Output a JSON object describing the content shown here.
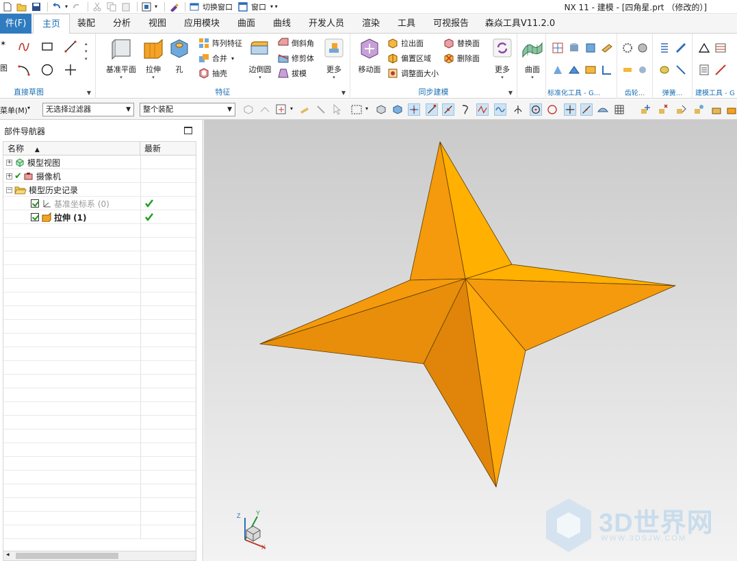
{
  "window": {
    "title": "NX 11 - 建模 - [四角星.prt （修改的）]",
    "quick_access": {
      "switch_window": "切换窗口",
      "window": "窗口"
    }
  },
  "ribbon": {
    "file_tab": "件(F)",
    "tabs": [
      "主页",
      "装配",
      "分析",
      "视图",
      "应用模块",
      "曲面",
      "曲线",
      "开发人员",
      "渲染",
      "工具",
      "可视报告",
      "森焱工具V11.2.0"
    ],
    "active_tab": "主页",
    "groups": {
      "sketch": {
        "label": "直接草图",
        "left_label": "图"
      },
      "feature": {
        "label": "特征",
        "datum_plane": "基准平面",
        "extrude": "拉伸",
        "hole": "孔",
        "pattern": "阵列特征",
        "unite": "合并",
        "shell": "抽壳",
        "edge_blend": "边倒圆",
        "chamfer": "倒斜角",
        "trim_body": "修剪体",
        "draft": "拔模",
        "more": "更多"
      },
      "sync": {
        "label": "同步建模",
        "move_face": "移动面",
        "pull_face": "拉出面",
        "offset_region": "偏置区域",
        "resize_face": "调整面大小",
        "replace_face": "替换面",
        "delete_face": "删除面",
        "more": "更多"
      },
      "surface": {
        "label": "曲面"
      },
      "std_tools": {
        "label": "标准化工具 - G..."
      },
      "gear": {
        "label": "齿轮..."
      },
      "spring": {
        "label": "弹簧..."
      },
      "modeling_tools": {
        "label": "建模工具 - G"
      }
    }
  },
  "selection_bar": {
    "menu": "菜单(M)",
    "filter": "无选择过滤器",
    "scope": "整个装配"
  },
  "navigator": {
    "title": "部件导航器",
    "columns": {
      "name": "名称",
      "latest": "最新"
    },
    "nodes": {
      "model_views": "模型视图",
      "camera": "摄像机",
      "history": "模型历史记录",
      "datum_csys": "基准坐标系 (0)",
      "extrude": "拉伸 (1)"
    }
  },
  "viewport": {
    "model": "four-pointed-star",
    "colors": {
      "face_light": "#FFB000",
      "face_mid": "#F59A0C",
      "face_dark": "#E0850A",
      "edge": "#5a3a00"
    },
    "triad": {
      "x": "X",
      "y": "Y",
      "z": "Z"
    }
  },
  "watermark": {
    "text": "3D世界网",
    "url": "WWW.3DSJW.COM"
  },
  "colors": {
    "accent": "#1a6fb5",
    "file_tab": "#2f7bbf"
  }
}
